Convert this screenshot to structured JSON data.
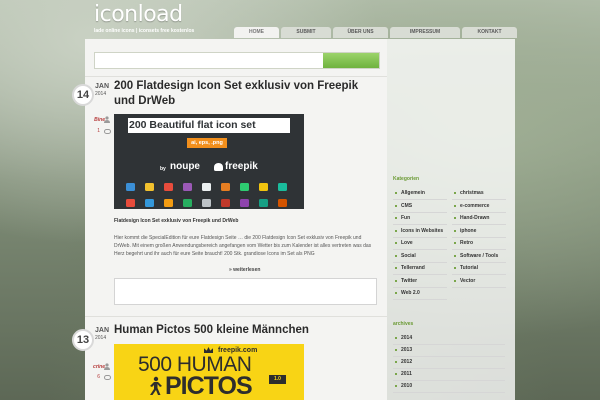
{
  "site": {
    "logo": "iconload",
    "tagline": "lade online icons | iconsets free kostenlos"
  },
  "nav": [
    "HOME",
    "SUBMIT",
    "ÜBER UNS",
    "IMPRESSUM",
    "KONTAKT"
  ],
  "posts": [
    {
      "day": "14",
      "month": "JAN",
      "year": "2014",
      "title": "200 Flatdesign Icon Set exklusiv von Freepik und DrWeb",
      "author": "Bine",
      "comments": "1",
      "image": {
        "headline": "200 Beautiful flat icon set",
        "formats": "ai, eps, .png",
        "by": "by",
        "brand1": "noupe",
        "brand2": "freepik"
      },
      "excerpt_title": "Flatdesign Icon Set exklusiv von Freepik und DrWeb",
      "excerpt": "Hier kommt die SpecialEdition für eure Flatdesign Seite … die 200 Flatdesign Icon Set exklusiv von Freepik und DrWeb. Mit einem großen Anwendungsbereich angefangen vom Wetter bis zum Kalender ist alles vertreten was das Herz begehrt und ihr auch für eure Seite braucht! 200 Stk. grandiose Icons im Set als PNG",
      "read_more": "» weiterlesen"
    },
    {
      "day": "13",
      "month": "JAN",
      "year": "2014",
      "title": "Human Pictos 500 kleine Männchen",
      "author": "crine",
      "comments": "6",
      "image": {
        "brand": "freepik.com",
        "line1": "500 HUMAN",
        "line2": "PICTOS",
        "version": "1.0"
      }
    }
  ],
  "sidebar": {
    "categories_heading": "Kategorien",
    "categories_left": [
      "Allgemein",
      "CMS",
      "Fun",
      "Icons in Websites",
      "Love",
      "Social",
      "Tellerrand",
      "Twitter",
      "Web 2.0"
    ],
    "categories_right": [
      "christmas",
      "e-commerce",
      "Hand-Drawn",
      "iphone",
      "Retro",
      "Software / Tools",
      "Tutorial",
      "Vector"
    ],
    "archives_heading": "archives",
    "archives": [
      "2014",
      "2013",
      "2012",
      "2011",
      "2010"
    ]
  },
  "colors": {
    "accent_green": "#6a9a33",
    "author_red": "#b53a3a",
    "search_button_green": "#7fc24a",
    "post2_yellow": "#f8d415",
    "post1_dark": "#2f3336",
    "format_orange": "#f28f1c"
  }
}
